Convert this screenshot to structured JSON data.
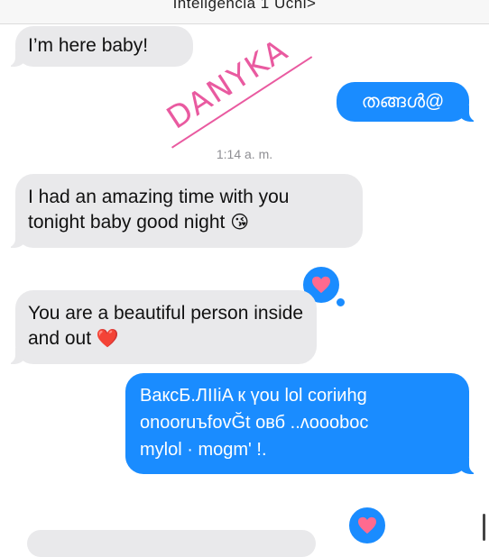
{
  "header": {
    "title": "Inteligencia 1 Uchi>"
  },
  "messages": [
    {
      "direction": "incoming",
      "text": "I’m here baby!"
    },
    {
      "direction": "outgoing",
      "text": "തങ്ങൾ@"
    },
    {
      "direction": "incoming",
      "text": "I had an amazing time with you tonight baby good night",
      "emoji": "😘"
    },
    {
      "direction": "incoming",
      "text": "You are a beautiful person inside and out",
      "emoji": "❤️",
      "reaction": "heart"
    },
    {
      "direction": "outgoing",
      "lines": [
        "BaкcБ.ЛIIiA к үou lol cоriиhg",
        "onооruъfоvĞt овб  ..ʌooоbоc",
        "mуlol  ·  mogm' !."
      ]
    },
    {
      "direction": "incoming",
      "text": "",
      "reaction": "heart"
    }
  ],
  "timestamp": "1:14 a. m.",
  "watermark": "DANYKA",
  "colors": {
    "incoming_bubble": "#e9e9eb",
    "outgoing_bubble": "#1a8cff",
    "reaction_heart": "#ff6a8f",
    "watermark": "#e95aa0"
  },
  "icons": {
    "reaction": "heart-icon"
  }
}
